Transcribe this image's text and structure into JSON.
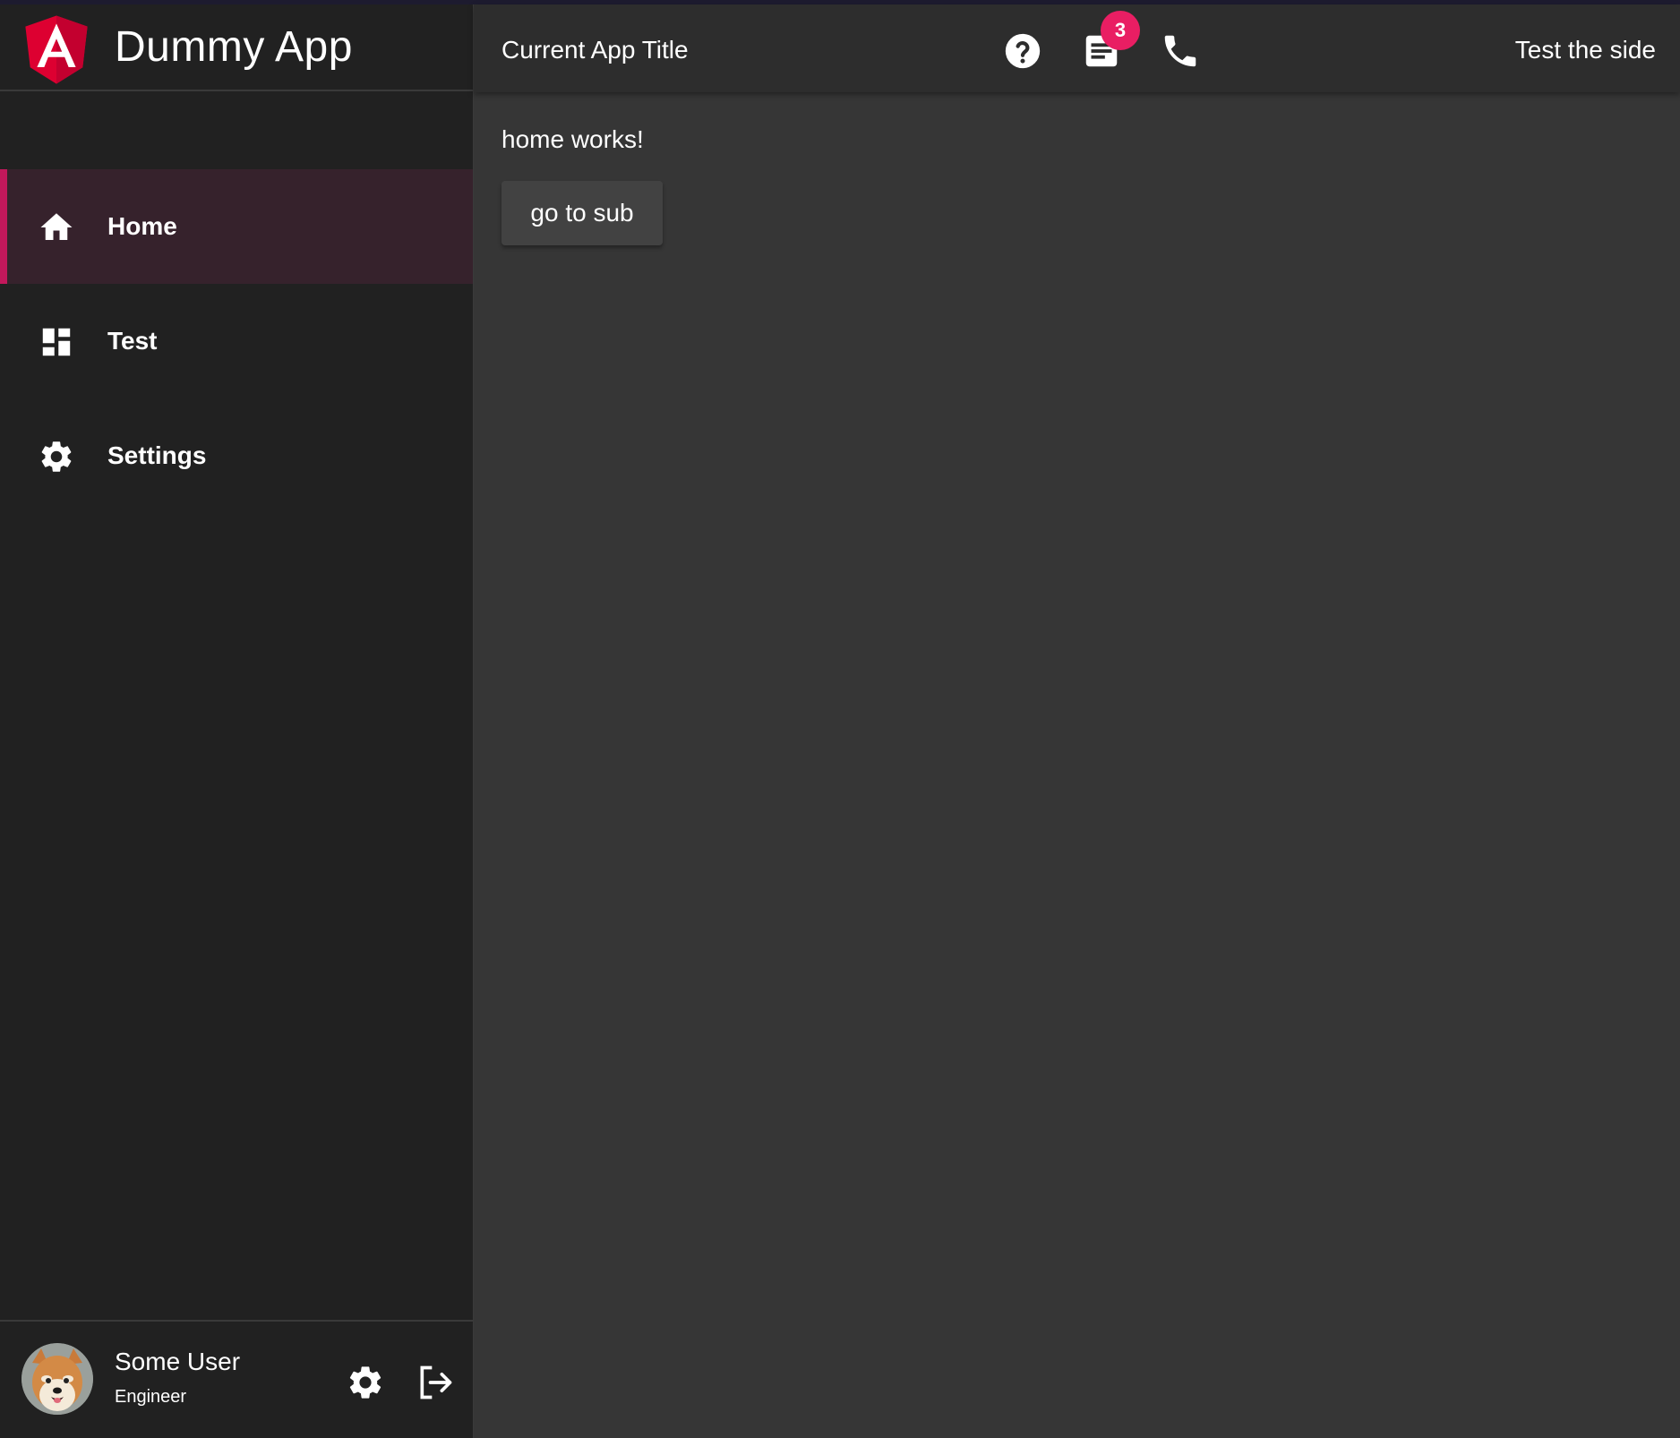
{
  "app": {
    "name": "Dummy App",
    "current_title": "Current App Title",
    "toolbar_link": "Test the side"
  },
  "toolbar": {
    "icons": [
      "help-icon",
      "notes-icon",
      "phone-icon"
    ],
    "notification_count": "3"
  },
  "sidebar": {
    "items": [
      {
        "label": "Home",
        "icon": "home-icon",
        "active": true
      },
      {
        "label": "Test",
        "icon": "dashboard-icon",
        "active": false
      },
      {
        "label": "Settings",
        "icon": "gear-icon",
        "active": false
      }
    ]
  },
  "user": {
    "name": "Some User",
    "role": "Engineer"
  },
  "content": {
    "text": "home works!",
    "button_label": "go to sub"
  },
  "colors": {
    "accent": "#c2185b",
    "badge": "#e91e63",
    "sidebar_bg": "#212121",
    "content_bg": "#363636",
    "toolbar_bg": "#2d2d2d"
  }
}
